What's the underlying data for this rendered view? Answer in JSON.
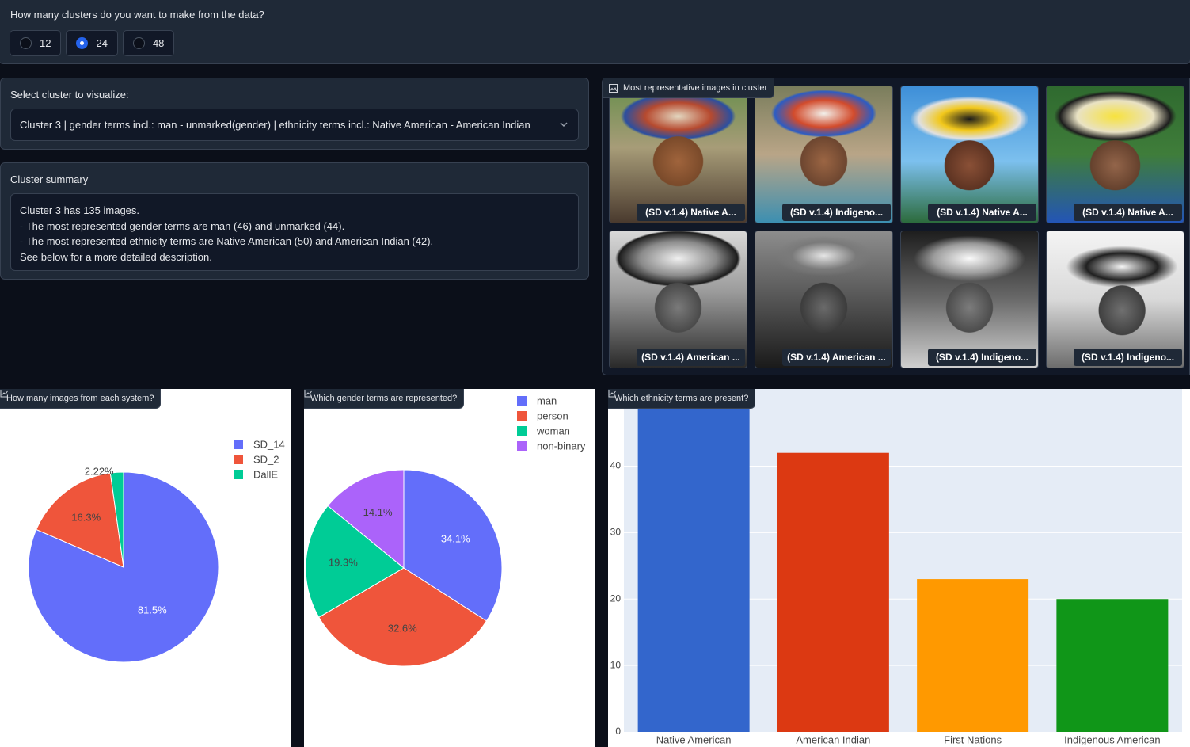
{
  "clusters": {
    "question": "How many clusters do you want to make from the data?",
    "options": [
      "12",
      "24",
      "48"
    ],
    "selected": "24"
  },
  "select_cluster": {
    "label": "Select cluster to visualize:",
    "value": "Cluster 3 | gender terms incl.: man - unmarked(gender) | ethnicity terms incl.: Native American - American Indian"
  },
  "summary": {
    "label": "Cluster summary",
    "lines": [
      "Cluster 3 has 135 images.",
      "- The most represented gender terms are man (46) and unmarked (44).",
      "- The most represented ethnicity terms are Native American (50) and American Indian (42).",
      "See below for a more detailed description."
    ]
  },
  "gallery": {
    "label": "Most representative images in cluster",
    "items": [
      {
        "caption": "(SD v.1.4) Native A...",
        "style": "color"
      },
      {
        "caption": "(SD v.1.4) Indigeno...",
        "style": "color c2"
      },
      {
        "caption": "(SD v.1.4) Native A...",
        "style": "color c3"
      },
      {
        "caption": "(SD v.1.4) Native A...",
        "style": "color c4"
      },
      {
        "caption": "(SD v.1.4) American ...",
        "style": "bw"
      },
      {
        "caption": "(SD v.1.4) American ...",
        "style": "bw b2"
      },
      {
        "caption": "(SD v.1.4) Indigeno...",
        "style": "bw b3"
      },
      {
        "caption": "(SD v.1.4) Indigeno...",
        "style": "bw b4"
      }
    ]
  },
  "plots": {
    "system_title": "How many images from each system?",
    "gender_title": "Which gender terms are represented?",
    "ethnicity_title": "Which ethnicity terms are present?"
  },
  "chart_data": [
    {
      "type": "pie",
      "labels": [
        "SD_14",
        "SD_2",
        "DallE"
      ],
      "values": [
        81.5,
        16.3,
        2.22
      ],
      "data_labels": [
        "81.5%",
        "16.3%",
        "2.22%"
      ],
      "colors": [
        "#636efa",
        "#ef553b",
        "#00cc96"
      ],
      "legend": "top-right"
    },
    {
      "type": "pie",
      "labels": [
        "man",
        "person",
        "woman",
        "non-binary"
      ],
      "values": [
        34.1,
        32.6,
        19.3,
        14.1
      ],
      "data_labels": [
        "34.1%",
        "32.6%",
        "19.3%",
        "14.1%"
      ],
      "colors": [
        "#636efa",
        "#ef553b",
        "#00cc96",
        "#ab63fa"
      ],
      "legend": "top-right"
    },
    {
      "type": "bar",
      "categories": [
        "Native American",
        "American Indian",
        "First Nations",
        "Indigenous American"
      ],
      "values": [
        50,
        42,
        23,
        20
      ],
      "colors": [
        "#3366cc",
        "#dc3912",
        "#ff9900",
        "#109618"
      ],
      "ylim": [
        0,
        49
      ],
      "yticks": [
        0,
        10,
        20,
        30,
        40
      ],
      "grid": true
    }
  ]
}
